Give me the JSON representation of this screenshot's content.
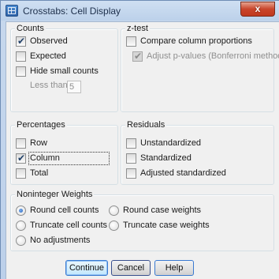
{
  "window": {
    "title": "Crosstabs: Cell Display",
    "close_label": "x"
  },
  "counts": {
    "legend": "Counts",
    "observed": {
      "label": "Observed",
      "checked": true
    },
    "expected": {
      "label": "Expected",
      "checked": false
    },
    "hide_small": {
      "label": "Hide small counts",
      "checked": false
    },
    "less_than_label": "Less than",
    "less_than_value": "5"
  },
  "ztest": {
    "legend": "z-test",
    "compare": {
      "label": "Compare column proportions",
      "checked": false
    },
    "adjust": {
      "label": "Adjust p-values (Bonferroni method)",
      "checked": true,
      "enabled": false
    }
  },
  "percentages": {
    "legend": "Percentages",
    "row": {
      "label": "Row",
      "checked": false
    },
    "column": {
      "label": "Column",
      "checked": true
    },
    "total": {
      "label": "Total",
      "checked": false
    }
  },
  "residuals": {
    "legend": "Residuals",
    "unstandardized": {
      "label": "Unstandardized",
      "checked": false
    },
    "standardized": {
      "label": "Standardized",
      "checked": false
    },
    "adjusted": {
      "label": "Adjusted standardized",
      "checked": false
    }
  },
  "noninteger": {
    "legend": "Noninteger Weights",
    "selected": "round_cell",
    "options": {
      "round_cell": "Round cell counts",
      "round_case": "Round case weights",
      "truncate_cell": "Truncate cell counts",
      "truncate_case": "Truncate case weights",
      "none": "No adjustments"
    }
  },
  "buttons": {
    "continue": "Continue",
    "cancel": "Cancel",
    "help": "Help"
  },
  "colors": {
    "title_bar": "#c7d8ed",
    "close": "#c9452b",
    "dialog_bg": "#f0f0f0",
    "accent": "#3a7ad1"
  }
}
